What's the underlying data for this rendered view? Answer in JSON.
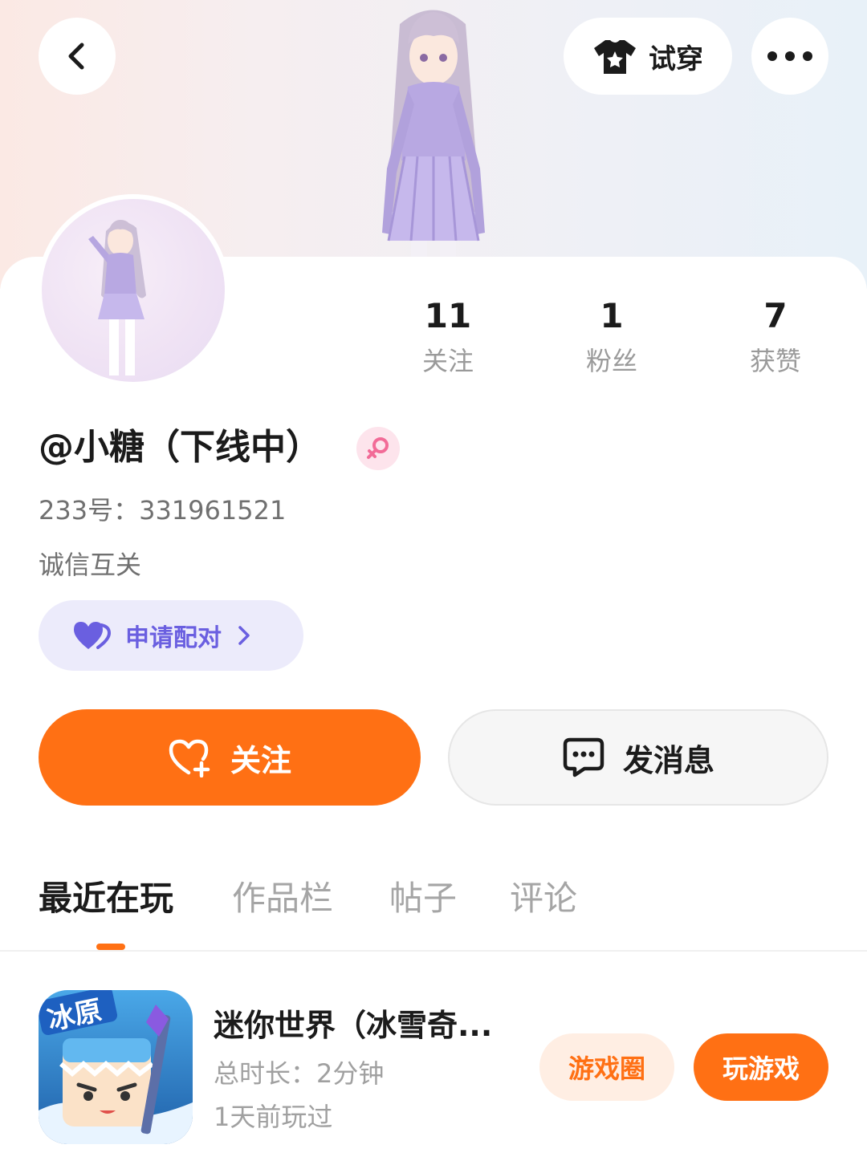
{
  "header": {
    "tryon_label": "试穿",
    "icons": [
      "back-icon",
      "shirt-icon",
      "more-icon"
    ]
  },
  "profile": {
    "username": "@小糖（下线中）",
    "gender": "female",
    "uid_text": "233号：331961521",
    "bio": "诚信互关",
    "stats": [
      {
        "value": "11",
        "label": "关注"
      },
      {
        "value": "1",
        "label": "粉丝"
      },
      {
        "value": "7",
        "label": "获赞"
      }
    ]
  },
  "actions": {
    "pair_label": "申请配对",
    "follow_label": "关注",
    "message_label": "发消息"
  },
  "tabs": [
    {
      "label": "最近在玩",
      "active": true
    },
    {
      "label": "作品栏",
      "active": false
    },
    {
      "label": "帖子",
      "active": false
    },
    {
      "label": "评论",
      "active": false
    }
  ],
  "recent_game": {
    "name": "迷你世界（冰雪奇...",
    "duration": "总时长：2分钟",
    "last_played": "1天前玩过",
    "icon_text": "冰原",
    "circle_label": "游戏圈",
    "play_label": "玩游戏"
  },
  "colors": {
    "accent": "#ff7014",
    "pair_purple": "#6a5fe0",
    "gender_pink": "#f26b97"
  }
}
